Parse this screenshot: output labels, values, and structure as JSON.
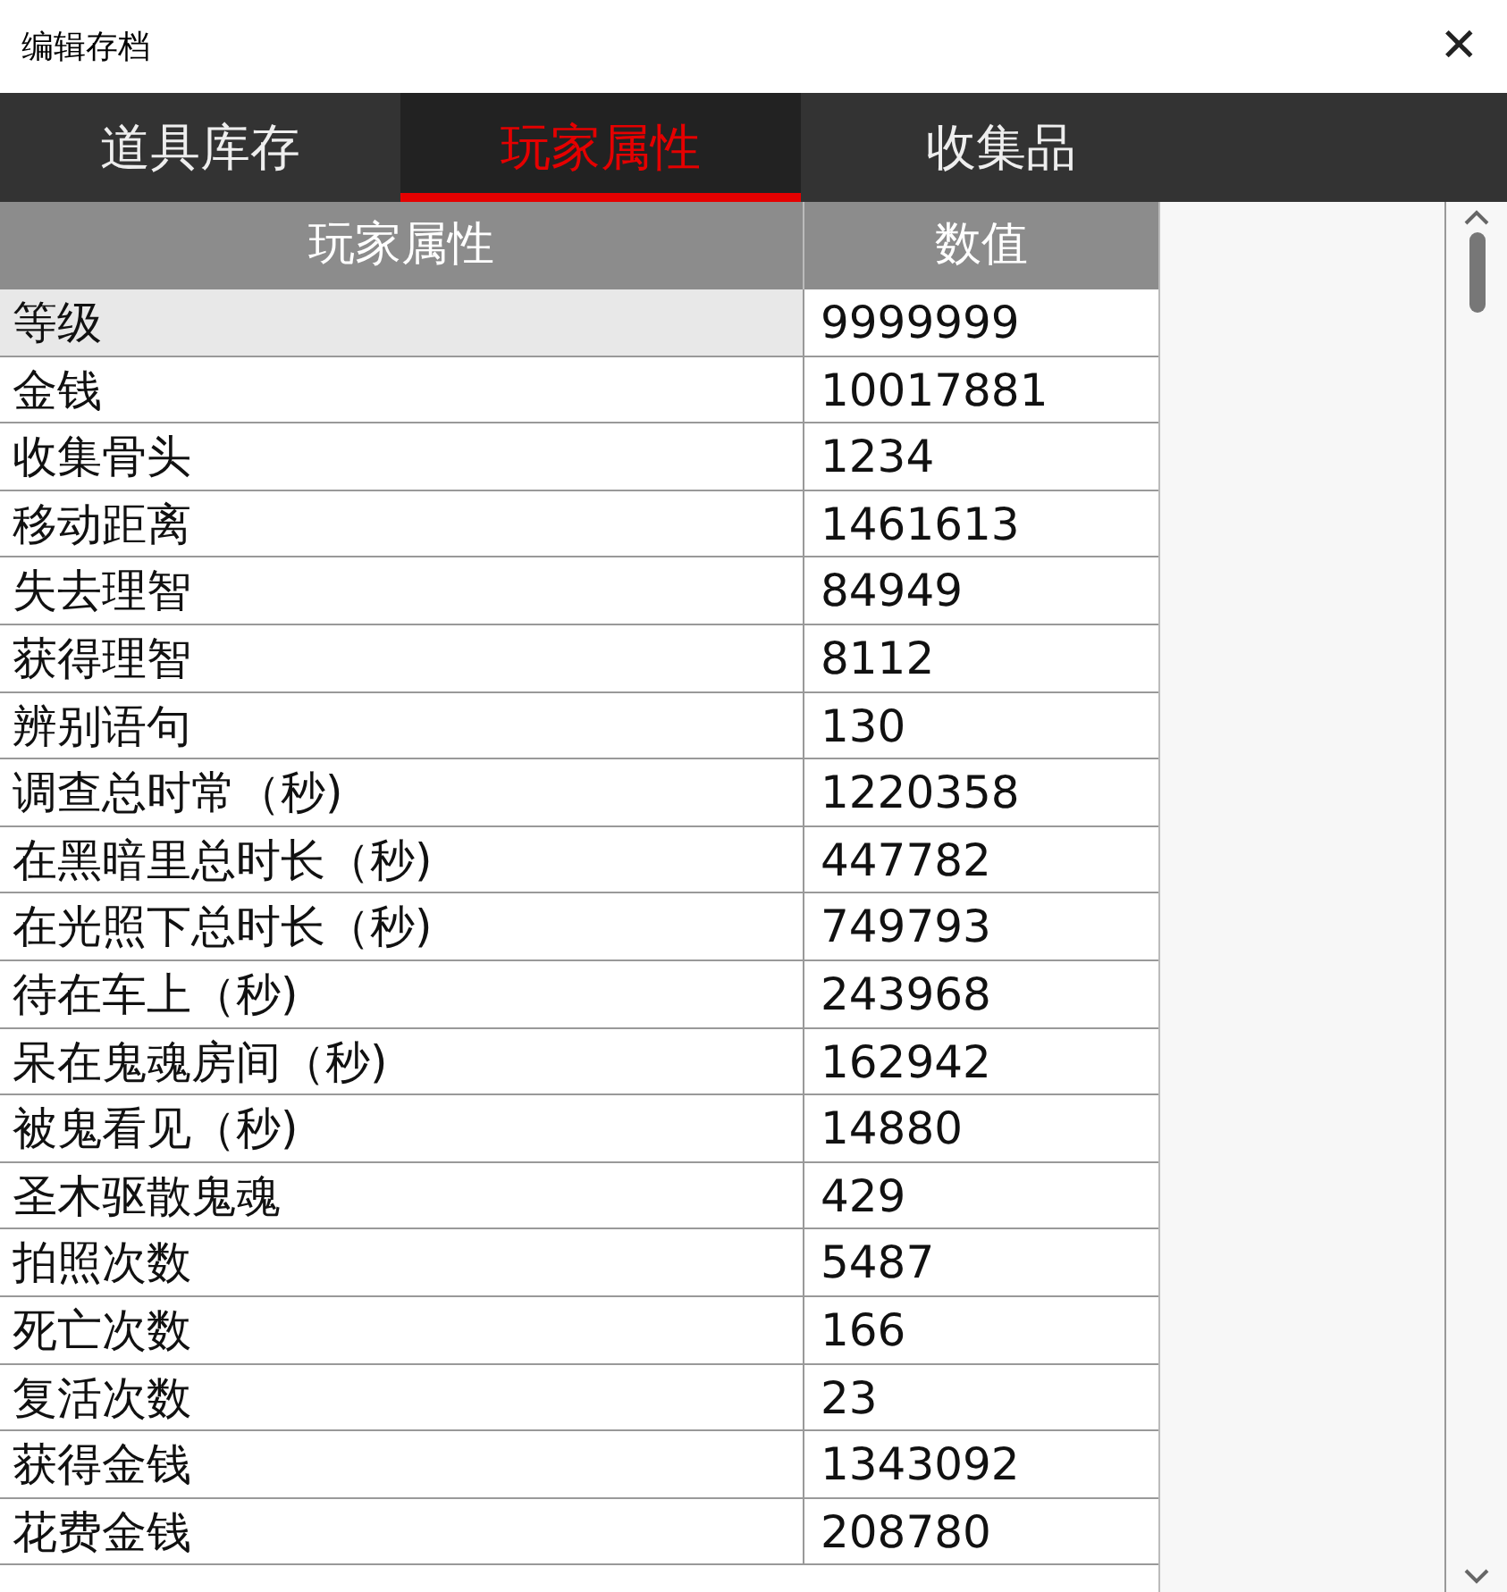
{
  "window": {
    "title": "编辑存档",
    "close": "✕"
  },
  "tabs": [
    {
      "label": "道具库存",
      "selected": false
    },
    {
      "label": "玩家属性",
      "selected": true
    },
    {
      "label": "收集品",
      "selected": false
    }
  ],
  "table": {
    "columns": [
      "玩家属性",
      "数值"
    ],
    "rows": [
      {
        "name": "等级",
        "value": "9999999",
        "selected": true
      },
      {
        "name": "金钱",
        "value": "10017881",
        "selected": false
      },
      {
        "name": "收集骨头",
        "value": "1234",
        "selected": false
      },
      {
        "name": "移动距离",
        "value": "1461613",
        "selected": false
      },
      {
        "name": "失去理智",
        "value": "84949",
        "selected": false
      },
      {
        "name": "获得理智",
        "value": "8112",
        "selected": false
      },
      {
        "name": "辨别语句",
        "value": "130",
        "selected": false
      },
      {
        "name": "调查总时常（秒)",
        "value": "1220358",
        "selected": false
      },
      {
        "name": "在黑暗里总时长（秒)",
        "value": "447782",
        "selected": false
      },
      {
        "name": "在光照下总时长（秒)",
        "value": "749793",
        "selected": false
      },
      {
        "name": "待在车上（秒)",
        "value": "243968",
        "selected": false
      },
      {
        "name": "呆在鬼魂房间（秒)",
        "value": "162942",
        "selected": false
      },
      {
        "name": "被鬼看见（秒)",
        "value": "14880",
        "selected": false
      },
      {
        "name": "圣木驱散鬼魂",
        "value": "429",
        "selected": false
      },
      {
        "name": "拍照次数",
        "value": "5487",
        "selected": false
      },
      {
        "name": "死亡次数",
        "value": "166",
        "selected": false
      },
      {
        "name": "复活次数",
        "value": "23",
        "selected": false
      },
      {
        "name": "获得金钱",
        "value": "1343092",
        "selected": false
      },
      {
        "name": "花费金钱",
        "value": "208780",
        "selected": false
      }
    ]
  }
}
